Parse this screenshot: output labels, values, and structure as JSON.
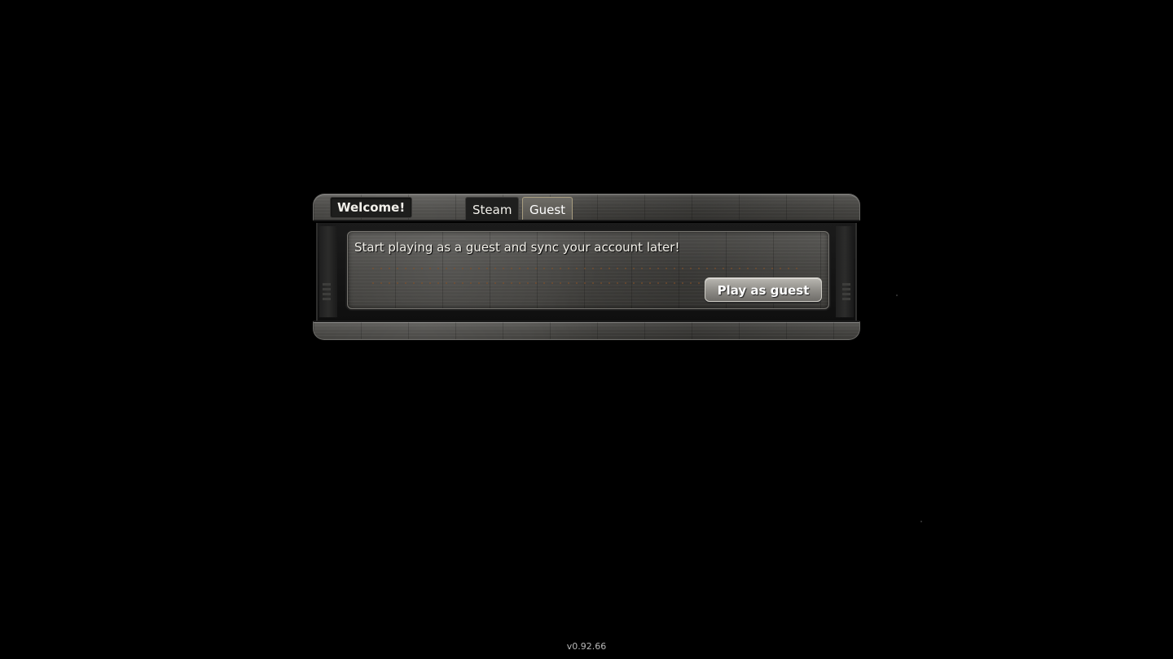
{
  "dialog": {
    "title": "Welcome!",
    "tabs": [
      {
        "label": "Steam",
        "active": false
      },
      {
        "label": "Guest",
        "active": true
      }
    ],
    "message": "Start playing as a guest and sync your account later!",
    "play_button_label": "Play as guest"
  },
  "footer": {
    "version": "v0.92.66"
  },
  "colors": {
    "background": "#000000",
    "panel_metal": "#4c4b48",
    "active_tab_border": "#a99e80",
    "text": "#f2f0ea"
  }
}
